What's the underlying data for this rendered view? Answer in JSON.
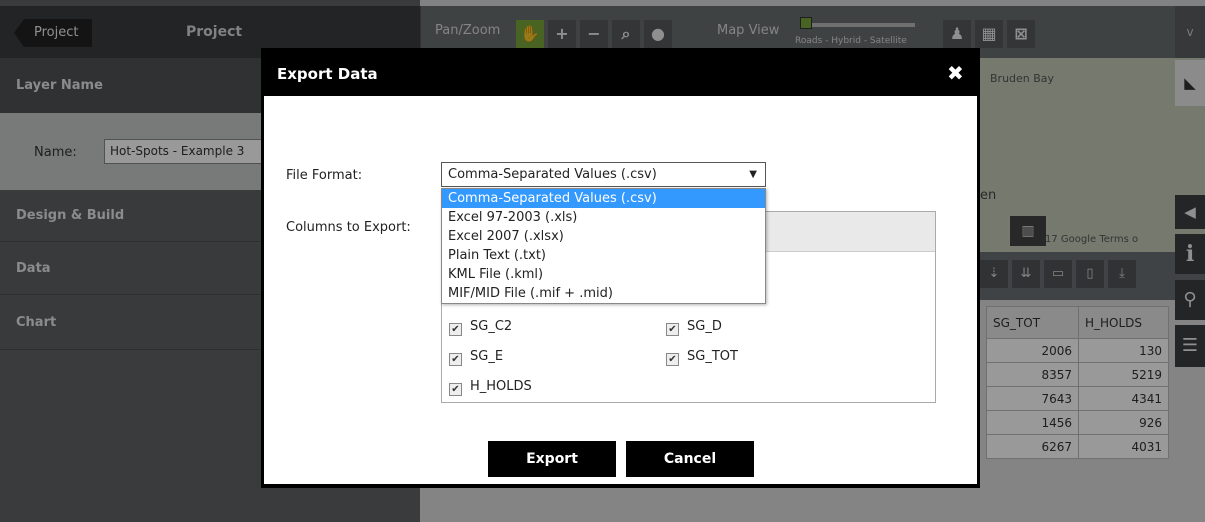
{
  "left_panel": {
    "project_button": "Project",
    "project_title": "Project",
    "layer_name_heading": "Layer Name",
    "name_label": "Name:",
    "name_value": "Hot-Spots - Example 3",
    "sections": [
      "Design & Build",
      "Data",
      "Chart"
    ]
  },
  "toolbar": {
    "pan_zoom_label": "Pan/Zoom",
    "map_view_label": "Map View",
    "map_view_options": "Roads - Hybrid - Satellite",
    "menu_toggle": "v"
  },
  "map": {
    "place_label_1": "Bruden Bay",
    "place_label_2": "en",
    "attribution": "17 Google   Terms o"
  },
  "grid": {
    "headers": [
      "SG_TOT",
      "H_HOLDS"
    ],
    "rows": [
      [
        "2006",
        "130"
      ],
      [
        "8357",
        "5219"
      ],
      [
        "7643",
        "4341"
      ],
      [
        "1456",
        "926"
      ],
      [
        "6267",
        "4031"
      ]
    ]
  },
  "dialog": {
    "title": "Export Data",
    "close_symbol": "✖",
    "file_format_label": "File Format:",
    "selected_format": "Comma-Separated Values (.csv)",
    "format_options": [
      "Comma-Separated Values (.csv)",
      "Excel 97-2003 (.xls)",
      "Excel 2007 (.xlsx)",
      "Plain Text (.txt)",
      "KML File (.kml)",
      "MIF/MID File (.mif + .mid)"
    ],
    "columns_label": "Columns to Export:",
    "columns": [
      {
        "name": "SG_C2",
        "checked": true
      },
      {
        "name": "SG_D",
        "checked": true
      },
      {
        "name": "SG_E",
        "checked": true
      },
      {
        "name": "SG_TOT",
        "checked": true
      },
      {
        "name": "H_HOLDS",
        "checked": true
      }
    ],
    "export_button": "Export",
    "cancel_button": "Cancel"
  },
  "colors": {
    "accent_green": "#7aa63a",
    "selection_blue": "#3399ff",
    "dialog_black": "#000000"
  }
}
